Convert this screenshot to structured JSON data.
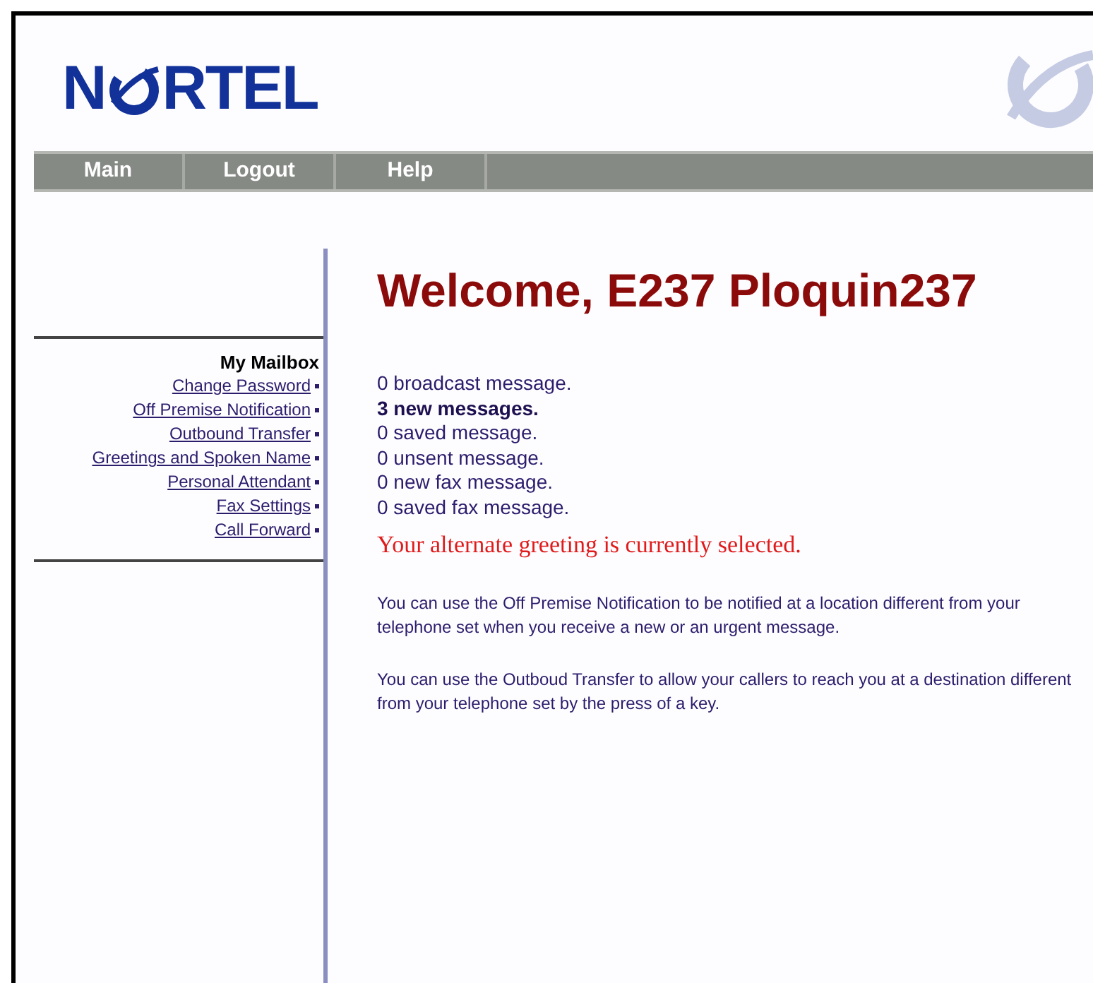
{
  "logo": {
    "before": "N",
    "after": "RTEL"
  },
  "nav": [
    {
      "label": "Main"
    },
    {
      "label": "Logout"
    },
    {
      "label": "Help"
    }
  ],
  "sidebar": {
    "heading": "My Mailbox",
    "links": [
      "Change Password",
      "Off Premise Notification",
      "Outbound Transfer",
      "Greetings and Spoken Name",
      "Personal Attendant",
      "Fax Settings",
      "Call Forward"
    ]
  },
  "welcome": "Welcome, E237 Ploquin237",
  "messages": [
    {
      "text": "0 broadcast message.",
      "emphasized": false
    },
    {
      "text": "3 new messages.",
      "emphasized": true
    },
    {
      "text": "0 saved message.",
      "emphasized": false
    },
    {
      "text": "0 unsent message.",
      "emphasized": false
    },
    {
      "text": "0 new fax message.",
      "emphasized": false
    },
    {
      "text": "0 saved fax message.",
      "emphasized": false
    }
  ],
  "greeting_notice": "Your alternate greeting is currently selected.",
  "info": [
    "You can use the Off Premise Notification to be notified at a location different from your telephone set when you receive a new or an urgent message.",
    "You can use the Outboud Transfer to allow your callers to reach you at a destination different from your telephone set by the press of a key."
  ]
}
